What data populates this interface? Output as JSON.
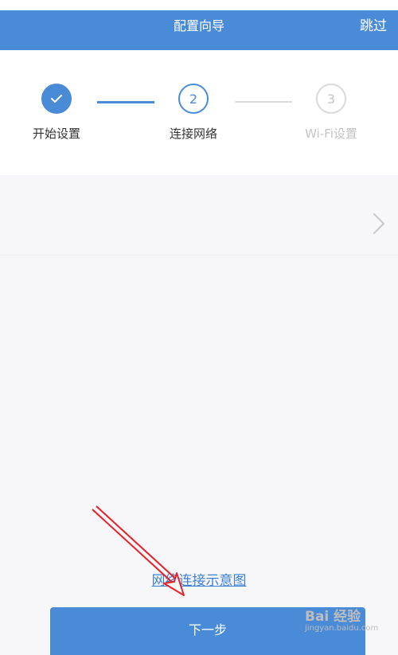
{
  "header": {
    "title": "配置向导",
    "skip_label": "跳过",
    "background": "#4a8bd8"
  },
  "steps": [
    {
      "number": "",
      "label": "开始设置",
      "state": "completed",
      "icon": "check-icon"
    },
    {
      "number": "2",
      "label": "连接网络",
      "state": "active"
    },
    {
      "number": "3",
      "label": "Wi-Fi设置",
      "state": "pending"
    }
  ],
  "network_row": {
    "icon": "chevron-right-icon"
  },
  "diagram_link": "网络连接示意图",
  "next_button": "下一步",
  "annotation": {
    "icon": "red-arrow",
    "color": "#e8202a"
  },
  "watermark": {
    "logo": "Bai 经验",
    "url": "jingyan.baidu.com"
  },
  "colors": {
    "accent": "#4a8bd8",
    "text": "#333333",
    "muted": "#c4c4c4",
    "background": "#f7f7f9"
  }
}
